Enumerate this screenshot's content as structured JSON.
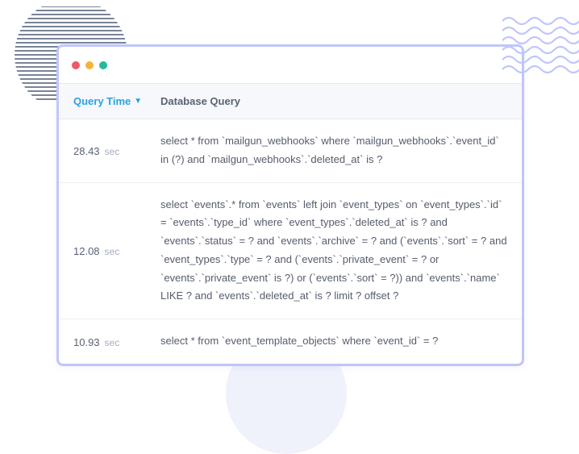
{
  "decor": {
    "left_lines_stroke": "#2b3a57",
    "wave_stroke": "#bfc6fa",
    "circle_fill": "#eff1fb"
  },
  "window": {
    "traffic_lights": [
      "red",
      "yellow",
      "green"
    ]
  },
  "table": {
    "headers": {
      "time": "Query Time",
      "query": "Database Query"
    },
    "sort_indicator": "▼",
    "time_unit": "sec",
    "rows": [
      {
        "time": "28.43",
        "query": "select * from `mailgun_webhooks` where `mailgun_webhooks`.`event_id` in (?) and `mailgun_webhooks`.`deleted_at` is ?"
      },
      {
        "time": "12.08",
        "query": "select `events`.* from `events` left join `event_types` on `event_types`.`id` = `events`.`type_id` where `event_types`.`deleted_at` is ? and `events`.`status` = ? and `events`.`archive` = ? and (`events`.`sort` = ? and `event_types`.`type` = ? and (`events`.`private_event` = ? or `events`.`private_event` is ?) or (`events`.`sort` = ?)) and `events`.`name` LIKE ? and `events`.`deleted_at` is ? limit ? offset ?"
      },
      {
        "time": "10.93",
        "query": "select * from `event_template_objects` where `event_id` = ?"
      }
    ]
  }
}
